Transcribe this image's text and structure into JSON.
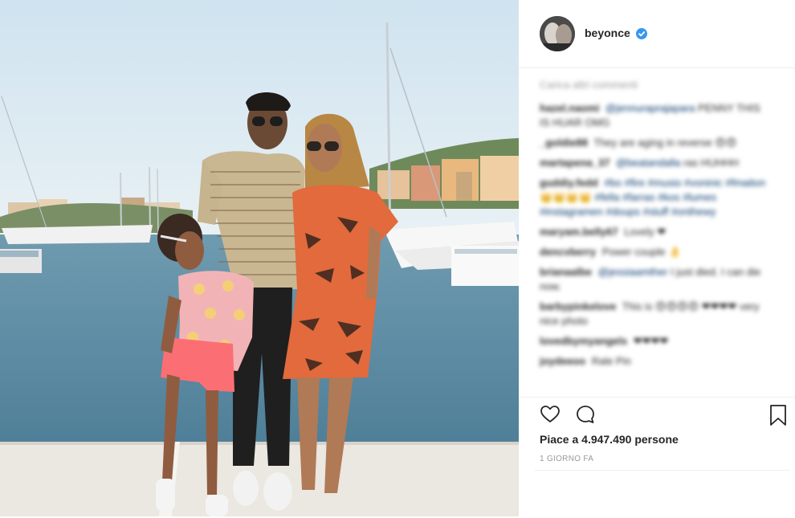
{
  "post": {
    "username": "beyonce",
    "verified": true,
    "photo_icon": "family-photo-marina"
  },
  "comments": {
    "load_more": "Carica altri commenti",
    "items": [
      {
        "user": "hazel.naomi",
        "mention": "@jennuraprajapara",
        "text": "PENNY THIS IS HUAR OMG"
      },
      {
        "user": "_goldie88",
        "mention": "",
        "text": "They are aging in reverse 😍😍"
      },
      {
        "user": "martapena_37",
        "mention": "@beatandalla",
        "text": "ras HUHHH"
      },
      {
        "user": "guddiy.fedd",
        "mention": "#bo #fire #musio #voninic #fmaiton",
        "text": "👑👑👑👑 #fella #farras #kos #lumes #instagramen #doups #stuff #onthewy"
      },
      {
        "user": "maryam.belly67",
        "mention": "",
        "text": "Lovely ❤"
      },
      {
        "user": "dencvberry",
        "mention": "",
        "text": "Power couple 👌"
      },
      {
        "user": "brianaalbe",
        "mention": "@jessiaamther",
        "text": "I just died. I can die now."
      },
      {
        "user": "barbypinkelove",
        "mention": "",
        "text": "This is 😍😍😍😍 ❤❤❤❤ very nice photo"
      },
      {
        "user": "lovedbymyangels",
        "mention": "",
        "text": "❤❤❤❤"
      },
      {
        "user": "joydeeoo",
        "mention": "",
        "text": "Rale Pin"
      }
    ]
  },
  "actions": {
    "like_icon": "heart-icon",
    "comment_icon": "comment-icon",
    "save_icon": "bookmark-icon",
    "likes_text": "Piace a 4.947.490 persone",
    "timestamp": "1 giorno fa"
  },
  "colors": {
    "verified_blue": "#3897f0",
    "text": "#262626",
    "muted": "#999999",
    "divider": "#efefef"
  }
}
